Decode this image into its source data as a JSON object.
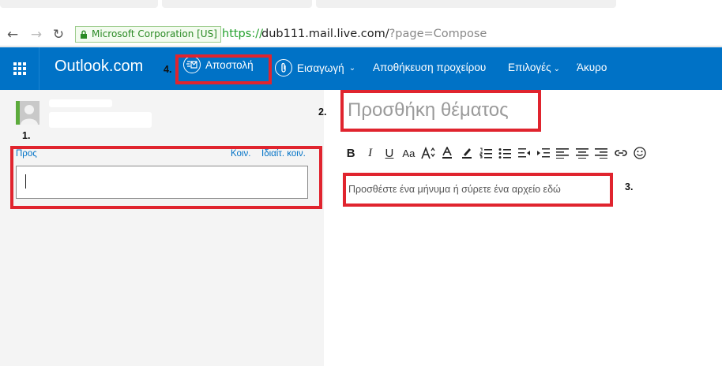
{
  "browser": {
    "ev_label": "Microsoft Corporation [US]",
    "url_scheme": "https://",
    "url_host_path": "dub111.mail.live.com/",
    "url_query": "?page=Compose",
    "back_icon": "arrow-left-icon",
    "forward_icon": "arrow-right-icon",
    "reload_icon": "reload-icon",
    "lock_icon": "lock-icon"
  },
  "header": {
    "brand": "Outlook.com",
    "send_label": "Αποστολή",
    "insert_label": "Εισαγωγή",
    "save_draft_label": "Αποθήκευση προχείρου",
    "options_label": "Επιλογές",
    "cancel_label": "Άκυρο",
    "colors": {
      "bar": "#0072c6"
    }
  },
  "compose": {
    "to_label": "Προς",
    "cc_label": "Κοιν.",
    "bcc_label": "Ιδιαίτ. κοιν.",
    "to_value": "",
    "subject_placeholder": "Προσθήκη θέματος",
    "body_placeholder": "Προσθέστε ένα μήνυμα ή σύρετε ένα αρχείο εδώ"
  },
  "toolbar": {
    "bold": "B",
    "italic": "I",
    "underline": "U",
    "font_size": "Aa"
  },
  "annotations": {
    "step1": "1.",
    "step2": "2.",
    "step3": "3.",
    "step4": "4.",
    "color": "#e0242e"
  }
}
